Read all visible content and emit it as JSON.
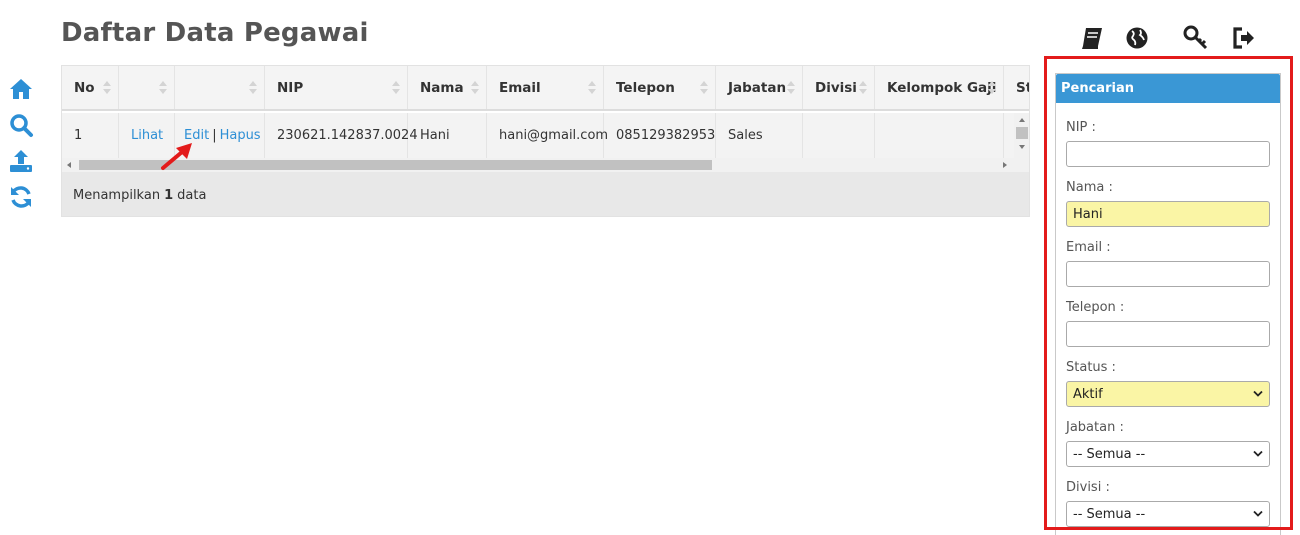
{
  "page": {
    "title": "Daftar Data Pegawai"
  },
  "left_nav": [
    {
      "icon": "home-icon",
      "color": "#2d8fd5"
    },
    {
      "icon": "search-icon",
      "color": "#2d8fd5"
    },
    {
      "icon": "upload-icon",
      "color": "#2d8fd5"
    },
    {
      "icon": "refresh-icon",
      "color": "#2d8fd5"
    }
  ],
  "top_icons": [
    {
      "icon": "book-icon"
    },
    {
      "icon": "globe-icon"
    },
    {
      "icon": "key-icon"
    },
    {
      "icon": "logout-icon"
    }
  ],
  "table": {
    "headers": [
      "No",
      "",
      "",
      "NIP",
      "Nama",
      "Email",
      "Telepon",
      "Jabatan",
      "Divisi",
      "Kelompok Gaji",
      "Sta"
    ],
    "rows": [
      {
        "no": "1",
        "view": "Lihat",
        "edit": "Edit",
        "separator": "|",
        "delete": "Hapus",
        "nip": "230621.142837.0024",
        "nama": "Hani",
        "email": "hani@gmail.com",
        "telepon": "085129382953",
        "jabatan": "Sales",
        "divisi": "",
        "kelompok_gaji": ""
      }
    ],
    "footer": {
      "prefix": "Menampilkan",
      "count": "1",
      "suffix": "data"
    }
  },
  "search_panel": {
    "title": "Pencarian",
    "fields": {
      "nip": {
        "label": "NIP :",
        "value": ""
      },
      "nama": {
        "label": "Nama :",
        "value": "Hani"
      },
      "email": {
        "label": "Email :",
        "value": ""
      },
      "telepon": {
        "label": "Telepon :",
        "value": ""
      },
      "status": {
        "label": "Status :",
        "value": "Aktif"
      },
      "jabatan": {
        "label": "Jabatan :",
        "value": "-- Semua --"
      },
      "divisi": {
        "label": "Divisi :",
        "value": "-- Semua --"
      }
    }
  },
  "colors": {
    "accent": "#2d8fd5",
    "panel_header": "#3a97d5",
    "highlight_border": "#e31b1b",
    "filled_field": "#faf5a5"
  }
}
